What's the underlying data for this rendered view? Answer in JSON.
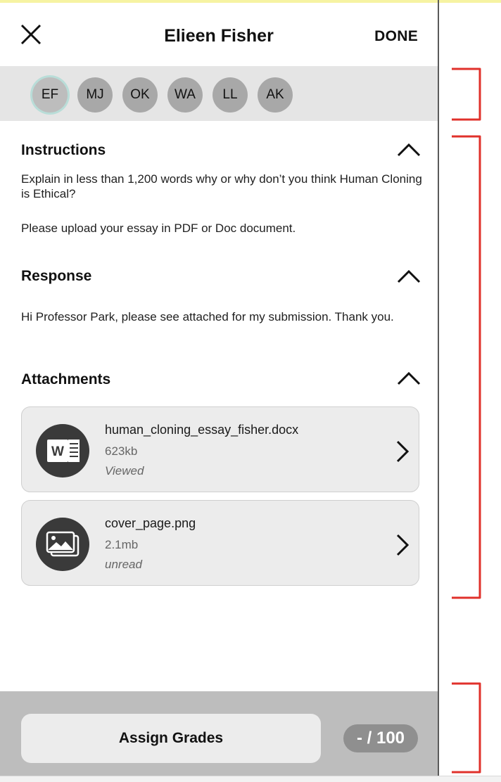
{
  "header": {
    "title": "Elieen Fisher",
    "done_label": "DONE",
    "close_icon": "close-icon"
  },
  "students": [
    {
      "initials": "EF",
      "active": true
    },
    {
      "initials": "MJ",
      "active": false
    },
    {
      "initials": "OK",
      "active": false
    },
    {
      "initials": "WA",
      "active": false
    },
    {
      "initials": "LL",
      "active": false
    },
    {
      "initials": "AK",
      "active": false
    }
  ],
  "instructions": {
    "title": "Instructions",
    "text1": "Explain in less than 1,200 words why or why don’t you think Human Cloning is Ethical?",
    "text2": "Please upload your essay in PDF or Doc document."
  },
  "response": {
    "title": "Response",
    "text": "Hi Professor Park, please see attached for my submission. Thank you."
  },
  "attachments": {
    "title": "Attachments",
    "items": [
      {
        "name": "human_cloning_essay_fisher.docx",
        "size": "623kb",
        "status": "Viewed",
        "icon": "word-document-icon"
      },
      {
        "name": "cover_page.png",
        "size": "2.1mb",
        "status": "unread",
        "icon": "image-file-icon"
      }
    ]
  },
  "footer": {
    "assign_label": "Assign Grades",
    "score": "- / 100"
  },
  "colors": {
    "annotation": "#e0312b",
    "highlight_strip": "#f6f3a2",
    "active_ring": "#b9ddd8"
  }
}
